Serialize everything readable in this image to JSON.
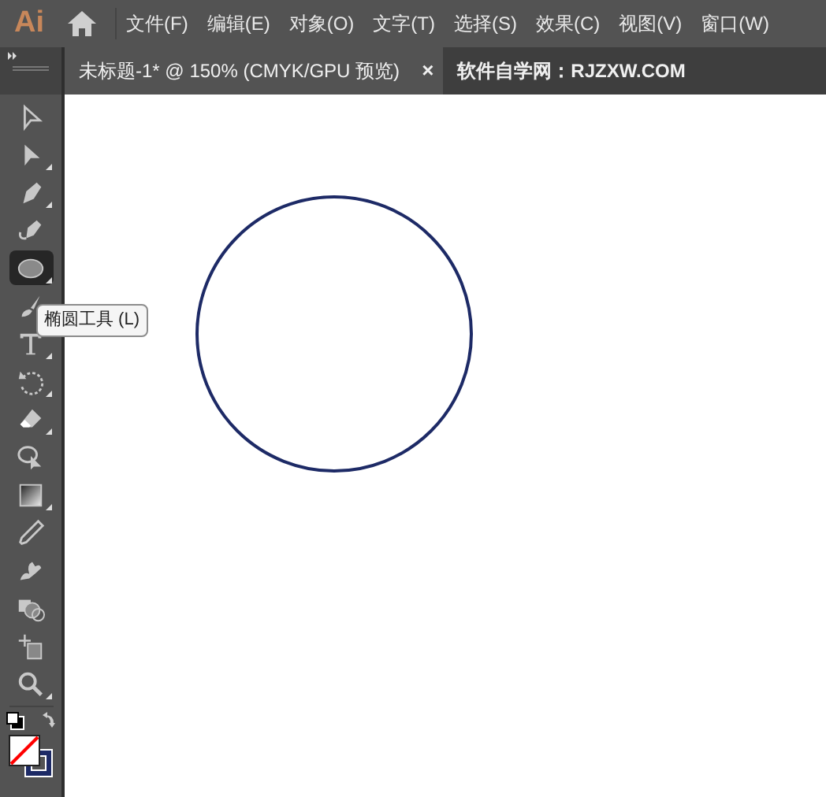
{
  "app_logo": "Ai",
  "menu": [
    "文件(F)",
    "编辑(E)",
    "对象(O)",
    "文字(T)",
    "选择(S)",
    "效果(C)",
    "视图(V)",
    "窗口(W)"
  ],
  "tabs": [
    {
      "label": "未标题-1* @ 150% (CMYK/GPU 预览)",
      "selected": true,
      "close": "×"
    },
    {
      "label": "软件自学网：RJZXW.COM",
      "selected": false
    }
  ],
  "tools": [
    {
      "selected": false,
      "flyout": false
    },
    {
      "selected": false,
      "flyout": true
    },
    {
      "selected": false,
      "flyout": true
    },
    {
      "selected": false,
      "flyout": false
    },
    {
      "selected": true,
      "flyout": true
    },
    {
      "selected": false
    },
    {
      "selected": false,
      "flyout": true
    },
    {
      "selected": false,
      "flyout": true
    },
    {
      "selected": false,
      "flyout": true
    },
    {
      "selected": false,
      "flyout": false
    },
    {
      "selected": false,
      "flyout": true
    },
    {
      "selected": false,
      "flyout": false
    },
    {
      "selected": false,
      "flyout": false
    },
    {
      "selected": false,
      "flyout": false
    },
    {
      "selected": false,
      "flyout": false
    },
    {
      "selected": false,
      "flyout": true
    }
  ],
  "tooltip": "椭圆工具 (L)"
}
